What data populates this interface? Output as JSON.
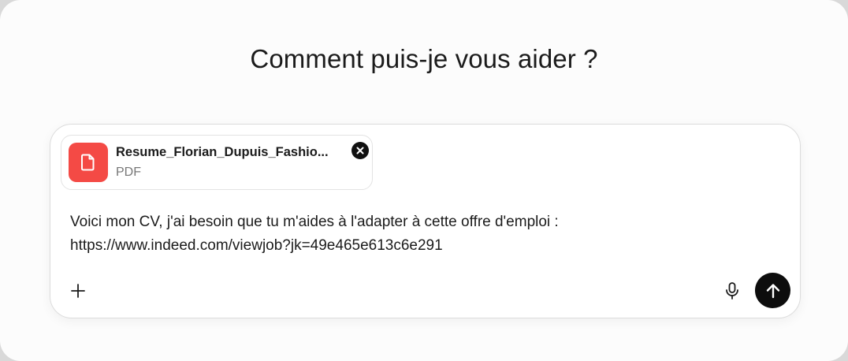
{
  "heading": "Comment puis-je vous aider ?",
  "attachment": {
    "file_name": "Resume_Florian_Dupuis_Fashio...",
    "file_type": "PDF",
    "icon": "document-icon",
    "icon_color": "#f44a45",
    "remove_icon": "close-circle-icon"
  },
  "composer": {
    "message_line_1": "Voici mon CV, j'ai besoin que tu m'aides à l'adapter à cette offre d'emploi :",
    "message_line_2": "https://www.indeed.com/viewjob?jk=49e465e613c6e291",
    "add_icon": "plus-icon",
    "mic_icon": "microphone-icon",
    "send_icon": "arrow-up-icon",
    "send_color": "#0d0d0d"
  }
}
